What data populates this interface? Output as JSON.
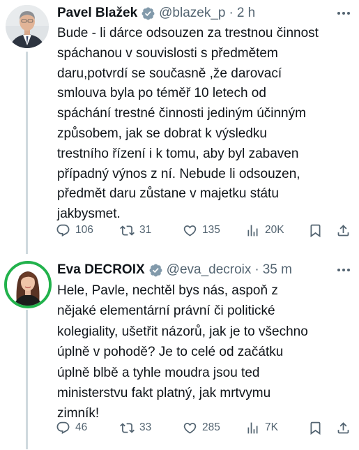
{
  "tweets": [
    {
      "author_name": "Pavel Blažek",
      "handle": "@blazek_p",
      "separator": "·",
      "time": "2 h",
      "body_lines": [
        "Bude - li dárce odsouzen za trestnou činnost",
        "spáchanou v souvislosti s předmětem",
        "daru,potvrdí  se současně ,že darovací",
        "smlouva byla po téměř 10 letech od",
        "spáchání trestné činnosti jediným účinným",
        "způsobem, jak se dobrat k výsledku",
        "trestního řízení i k tomu, aby byl zabaven",
        "případný výnos z ní. Nebude li odsouzen,",
        "předmět daru zůstane v majetku státu",
        "jakbysmet."
      ],
      "replies": "106",
      "retweets": "31",
      "likes": "135",
      "views": "20K"
    },
    {
      "author_name": "Eva DECROIX",
      "handle": "@eva_decroix",
      "separator": "·",
      "time": "35 m",
      "body_lines": [
        "Hele, Pavle, nechtěl bys nás, aspoň z",
        "nějaké elementární právní či politické",
        "kolegiality, ušetřit názorů, jak je to všechno",
        "úplně v pohodě? Je to celé od začátku",
        "úplně blbě a tyhle moudra jsou ted",
        "ministerstvu fakt platný, jak mrtvymu",
        "zimník!"
      ],
      "replies": "46",
      "retweets": "33",
      "likes": "285",
      "views": "7K"
    }
  ],
  "colors": {
    "verified_badge": "#829aab",
    "avatar_ring": "#22b24c",
    "muted_text": "#536471",
    "thread_line": "#cfd9de"
  },
  "icons": [
    "more-icon",
    "verified-icon",
    "reply-icon",
    "retweet-icon",
    "like-icon",
    "views-icon",
    "bookmark-icon",
    "share-icon"
  ]
}
